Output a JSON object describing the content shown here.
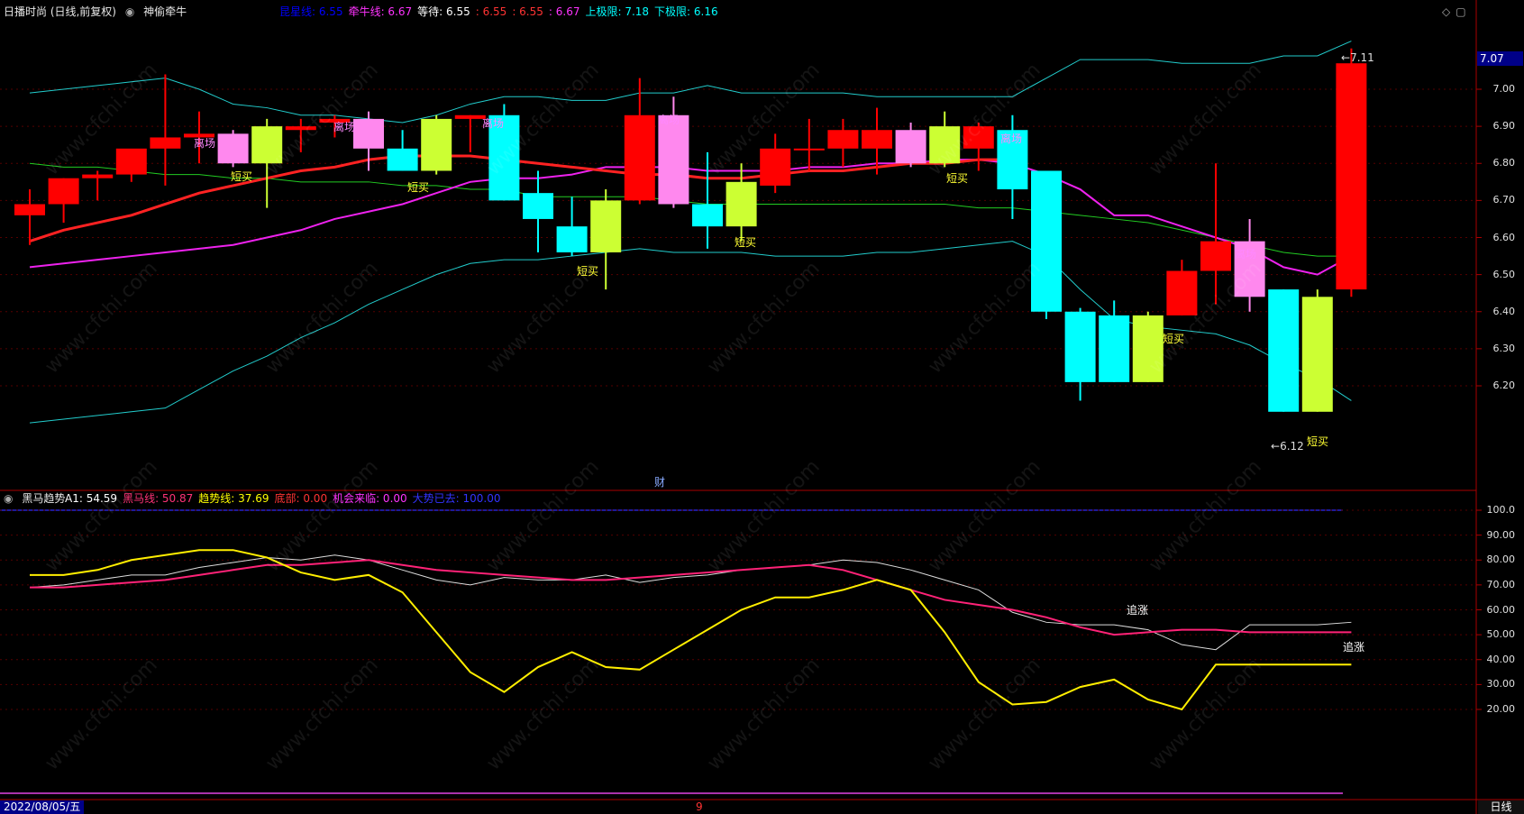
{
  "title": "日播时尚 (日线,前复权)",
  "indicator_name": "神偷牵牛",
  "top_legend": [
    {
      "label": "昆星线: 6.55",
      "color": "#0000ff"
    },
    {
      "label": "牵牛线: 6.67",
      "color": "#ff33ff"
    },
    {
      "label": "等待: 6.55",
      "color": "#ffffff"
    },
    {
      "label": ": 6.55",
      "color": "#ff3333"
    },
    {
      "label": ": 6.55",
      "color": "#ff3333"
    },
    {
      "label": ": 6.67",
      "color": "#ff33ff"
    },
    {
      "label": "上极限: 7.18",
      "color": "#00ffff"
    },
    {
      "label": "下极限: 6.16",
      "color": "#00ffff"
    }
  ],
  "current_price_tag": "7.07",
  "price_axis": [
    "7.00",
    "6.90",
    "6.80",
    "6.70",
    "6.60",
    "6.50",
    "6.40",
    "6.30",
    "6.20"
  ],
  "high_annot": "7.11",
  "low_annot": "6.12",
  "event_mark": "财",
  "sub_indicator_name": "黑马趋势",
  "sub_legend": [
    {
      "label": "A1: 54.59",
      "color": "#ffffff"
    },
    {
      "label": "黑马线: 50.87",
      "color": "#ff3377"
    },
    {
      "label": "趋势线: 37.69",
      "color": "#ffff00"
    },
    {
      "label": "底部: 0.00",
      "color": "#ff3333"
    },
    {
      "label": "机会来临: 0.00",
      "color": "#ff33ff"
    },
    {
      "label": "大势已去: 100.00",
      "color": "#3333ff"
    }
  ],
  "sub_axis": [
    "100.0",
    "90.00",
    "80.00",
    "70.00",
    "60.00",
    "50.00",
    "40.00",
    "30.00",
    "20.00"
  ],
  "annots": {
    "leave": "离场",
    "short_buy": "短买",
    "chase": "追涨"
  },
  "date_label": "2022/08/05/五",
  "bottom_mark": "9",
  "period_label": "日线",
  "watermark": "www.cfchi.com",
  "colors": {
    "up": "#ff0000",
    "down": "#00ffff",
    "pink": "#ff88ee",
    "yellow": "#ccff33"
  },
  "chart_data": [
    {
      "type": "candlestick",
      "title": "日播时尚 (日线,前复权)",
      "ylim": [
        6.1,
        7.2
      ],
      "candles": [
        {
          "o": 6.66,
          "h": 6.73,
          "l": 6.58,
          "c": 6.69,
          "color": "up"
        },
        {
          "o": 6.69,
          "h": 6.76,
          "l": 6.64,
          "c": 6.76,
          "color": "up"
        },
        {
          "o": 6.76,
          "h": 6.78,
          "l": 6.7,
          "c": 6.77,
          "color": "up"
        },
        {
          "o": 6.77,
          "h": 6.81,
          "l": 6.75,
          "c": 6.84,
          "color": "up"
        },
        {
          "o": 6.84,
          "h": 7.04,
          "l": 6.74,
          "c": 6.87,
          "color": "up"
        },
        {
          "o": 6.87,
          "h": 6.94,
          "l": 6.8,
          "c": 6.88,
          "color": "up"
        },
        {
          "o": 6.88,
          "h": 6.89,
          "l": 6.79,
          "c": 6.8,
          "color": "pink"
        },
        {
          "o": 6.8,
          "h": 6.92,
          "l": 6.68,
          "c": 6.9,
          "color": "yellow"
        },
        {
          "o": 6.9,
          "h": 6.92,
          "l": 6.83,
          "c": 6.89,
          "color": "up"
        },
        {
          "o": 6.91,
          "h": 6.93,
          "l": 6.87,
          "c": 6.92,
          "color": "up"
        },
        {
          "o": 6.92,
          "h": 6.94,
          "l": 6.78,
          "c": 6.84,
          "color": "pink"
        },
        {
          "o": 6.84,
          "h": 6.89,
          "l": 6.78,
          "c": 6.78,
          "color": "down"
        },
        {
          "o": 6.78,
          "h": 6.93,
          "l": 6.77,
          "c": 6.92,
          "color": "yellow"
        },
        {
          "o": 6.92,
          "h": 6.93,
          "l": 6.83,
          "c": 6.93,
          "color": "up"
        },
        {
          "o": 6.93,
          "h": 6.96,
          "l": 6.7,
          "c": 6.7,
          "color": "down"
        },
        {
          "o": 6.72,
          "h": 6.78,
          "l": 6.56,
          "c": 6.65,
          "color": "down"
        },
        {
          "o": 6.63,
          "h": 6.71,
          "l": 6.55,
          "c": 6.56,
          "color": "down"
        },
        {
          "o": 6.56,
          "h": 6.73,
          "l": 6.46,
          "c": 6.7,
          "color": "yellow"
        },
        {
          "o": 6.7,
          "h": 7.03,
          "l": 6.69,
          "c": 6.93,
          "color": "up"
        },
        {
          "o": 6.93,
          "h": 6.98,
          "l": 6.68,
          "c": 6.69,
          "color": "pink"
        },
        {
          "o": 6.69,
          "h": 6.83,
          "l": 6.57,
          "c": 6.63,
          "color": "down"
        },
        {
          "o": 6.63,
          "h": 6.8,
          "l": 6.59,
          "c": 6.75,
          "color": "yellow"
        },
        {
          "o": 6.74,
          "h": 6.88,
          "l": 6.72,
          "c": 6.84,
          "color": "up"
        },
        {
          "o": 6.84,
          "h": 6.92,
          "l": 6.78,
          "c": 6.84,
          "color": "up"
        },
        {
          "o": 6.84,
          "h": 6.92,
          "l": 6.79,
          "c": 6.89,
          "color": "up"
        },
        {
          "o": 6.89,
          "h": 6.95,
          "l": 6.77,
          "c": 6.84,
          "color": "up"
        },
        {
          "o": 6.89,
          "h": 6.91,
          "l": 6.79,
          "c": 6.8,
          "color": "pink"
        },
        {
          "o": 6.8,
          "h": 6.94,
          "l": 6.79,
          "c": 6.9,
          "color": "yellow"
        },
        {
          "o": 6.9,
          "h": 6.91,
          "l": 6.78,
          "c": 6.84,
          "color": "up"
        },
        {
          "o": 6.89,
          "h": 6.93,
          "l": 6.65,
          "c": 6.73,
          "color": "down"
        },
        {
          "o": 6.78,
          "h": 6.78,
          "l": 6.38,
          "c": 6.4,
          "color": "down"
        },
        {
          "o": 6.4,
          "h": 6.41,
          "l": 6.16,
          "c": 6.21,
          "color": "down"
        },
        {
          "o": 6.39,
          "h": 6.43,
          "l": 6.21,
          "c": 6.21,
          "color": "down"
        },
        {
          "o": 6.21,
          "h": 6.4,
          "l": 6.21,
          "c": 6.39,
          "color": "yellow"
        },
        {
          "o": 6.39,
          "h": 6.54,
          "l": 6.39,
          "c": 6.51,
          "color": "up"
        },
        {
          "o": 6.51,
          "h": 6.8,
          "l": 6.42,
          "c": 6.59,
          "color": "up"
        },
        {
          "o": 6.59,
          "h": 6.65,
          "l": 6.4,
          "c": 6.44,
          "color": "pink"
        },
        {
          "o": 6.46,
          "h": 6.46,
          "l": 6.13,
          "c": 6.13,
          "color": "down"
        },
        {
          "o": 6.13,
          "h": 6.46,
          "l": 6.13,
          "c": 6.44,
          "color": "yellow"
        },
        {
          "o": 6.46,
          "h": 7.11,
          "l": 6.44,
          "c": 7.07,
          "color": "up"
        }
      ],
      "upper_band": [
        6.99,
        7.0,
        7.01,
        7.02,
        7.03,
        7.0,
        6.96,
        6.95,
        6.93,
        6.93,
        6.92,
        6.91,
        6.93,
        6.96,
        6.98,
        6.98,
        6.97,
        6.97,
        6.99,
        6.99,
        7.01,
        6.99,
        6.99,
        6.99,
        6.99,
        6.98,
        6.98,
        6.98,
        6.98,
        6.98,
        7.03,
        7.08,
        7.08,
        7.08,
        7.07,
        7.07,
        7.07,
        7.09,
        7.09,
        7.13
      ],
      "lower_band": [
        6.1,
        6.11,
        6.12,
        6.13,
        6.14,
        6.19,
        6.24,
        6.28,
        6.33,
        6.37,
        6.42,
        6.46,
        6.5,
        6.53,
        6.54,
        6.54,
        6.55,
        6.56,
        6.57,
        6.56,
        6.56,
        6.56,
        6.55,
        6.55,
        6.55,
        6.56,
        6.56,
        6.57,
        6.58,
        6.59,
        6.55,
        6.46,
        6.38,
        6.36,
        6.35,
        6.34,
        6.31,
        6.26,
        6.22,
        6.16
      ],
      "mid_line": [
        6.8,
        6.79,
        6.79,
        6.78,
        6.77,
        6.77,
        6.76,
        6.76,
        6.75,
        6.75,
        6.75,
        6.74,
        6.74,
        6.73,
        6.73,
        6.71,
        6.71,
        6.71,
        6.71,
        6.7,
        6.69,
        6.69,
        6.69,
        6.69,
        6.69,
        6.69,
        6.69,
        6.69,
        6.68,
        6.68,
        6.67,
        6.66,
        6.65,
        6.64,
        6.62,
        6.6,
        6.58,
        6.56,
        6.55,
        6.55
      ],
      "magenta_line": [
        6.52,
        6.53,
        6.54,
        6.55,
        6.56,
        6.57,
        6.58,
        6.6,
        6.62,
        6.65,
        6.67,
        6.69,
        6.72,
        6.75,
        6.76,
        6.76,
        6.77,
        6.79,
        6.79,
        6.79,
        6.78,
        6.78,
        6.78,
        6.79,
        6.79,
        6.8,
        6.8,
        6.81,
        6.81,
        6.8,
        6.77,
        6.73,
        6.66,
        6.66,
        6.63,
        6.6,
        6.57,
        6.52,
        6.5,
        6.55
      ],
      "red_line": [
        6.59,
        6.62,
        6.64,
        6.66,
        6.69,
        6.72,
        6.74,
        6.76,
        6.78,
        6.79,
        6.81,
        6.82,
        6.82,
        6.82,
        6.81,
        6.8,
        6.79,
        6.78,
        6.77,
        6.77,
        6.76,
        6.76,
        6.77,
        6.78,
        6.78,
        6.79,
        6.8,
        6.8,
        6.81,
        6.81,
        6.79,
        6.72,
        6.6,
        6.45,
        6.37,
        6.46,
        6.52,
        6.56,
        6.55,
        6.55
      ]
    },
    {
      "type": "line",
      "title": "黑马趋势",
      "ylim": [
        0,
        105
      ],
      "series": [
        {
          "name": "A1",
          "values": [
            69,
            70,
            72,
            74,
            74,
            77,
            79,
            81,
            80,
            82,
            80,
            76,
            72,
            70,
            73,
            72,
            72,
            74,
            71,
            73,
            74,
            76,
            77,
            78,
            80,
            79,
            76,
            72,
            68,
            59,
            55,
            54,
            54,
            52,
            46,
            44,
            54,
            54,
            54,
            55
          ]
        },
        {
          "name": "黑马线",
          "values": [
            69,
            69,
            70,
            71,
            72,
            74,
            76,
            78,
            78,
            79,
            80,
            78,
            76,
            75,
            74,
            73,
            72,
            72,
            73,
            74,
            75,
            76,
            77,
            78,
            76,
            72,
            68,
            64,
            62,
            60,
            57,
            53,
            50,
            51,
            52,
            52,
            51,
            51,
            51,
            51
          ]
        },
        {
          "name": "趋势线",
          "values": [
            74,
            74,
            76,
            80,
            82,
            84,
            84,
            81,
            75,
            72,
            74,
            67,
            51,
            35,
            27,
            37,
            43,
            37,
            36,
            44,
            52,
            60,
            65,
            65,
            68,
            72,
            68,
            51,
            31,
            22,
            23,
            29,
            32,
            24,
            20,
            38,
            38,
            38,
            38,
            38
          ]
        }
      ]
    }
  ]
}
